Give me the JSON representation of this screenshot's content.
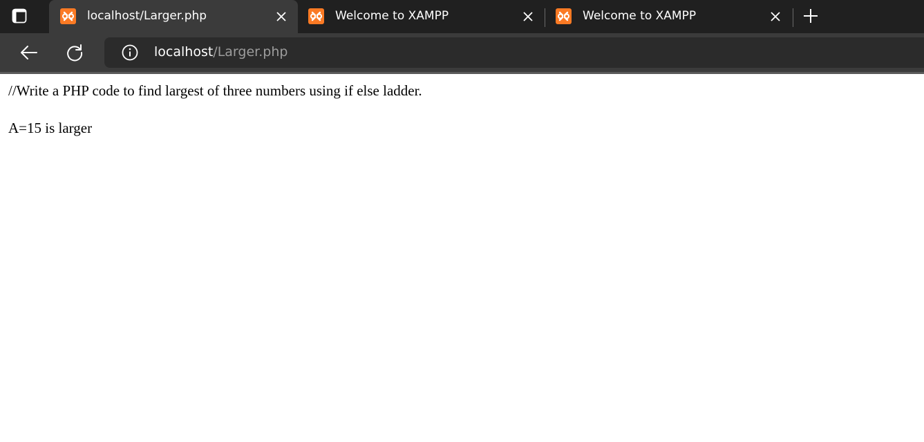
{
  "tabs": [
    {
      "title": "localhost/Larger.php",
      "active": true,
      "icon": "xampp-icon"
    },
    {
      "title": "Welcome to XAMPP",
      "active": false,
      "icon": "xampp-icon"
    },
    {
      "title": "Welcome to XAMPP",
      "active": false,
      "icon": "xampp-icon"
    }
  ],
  "address_bar": {
    "host": "localhost",
    "path": "/Larger.php"
  },
  "page": {
    "lines": [
      "//Write a PHP code to find largest of three numbers using if else ladder.",
      "A=15 is larger"
    ]
  },
  "colors": {
    "tabstrip_bg": "#202020",
    "toolbar_bg": "#3b3b3b",
    "favicon_orange": "#fb7a24"
  }
}
